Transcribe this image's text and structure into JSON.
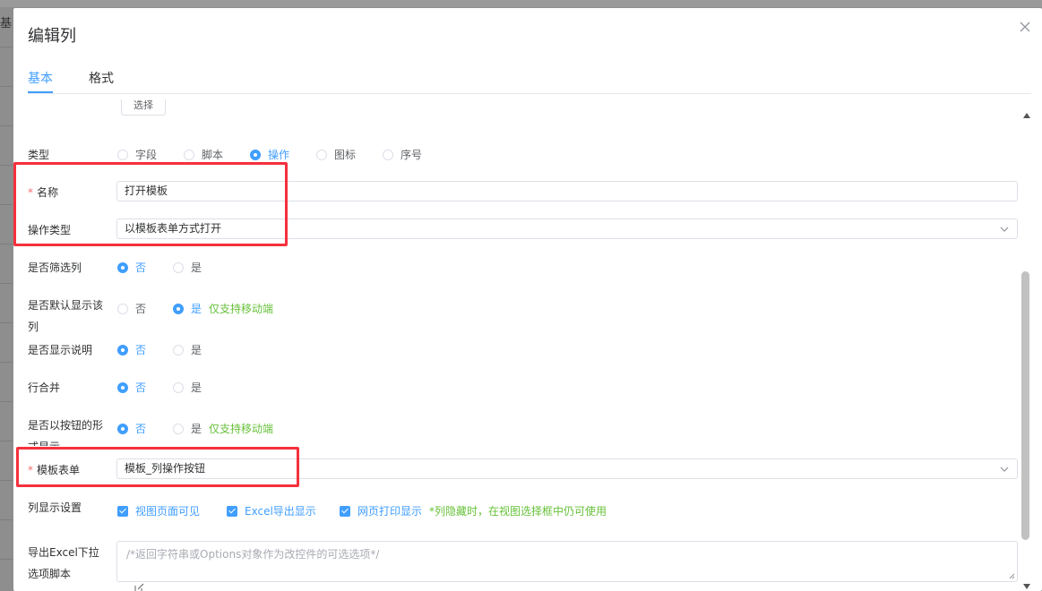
{
  "backdrop": {
    "partial_text": "基本"
  },
  "dialog": {
    "title": "编辑列"
  },
  "tabs": [
    {
      "label": "基本",
      "active": true
    },
    {
      "label": "格式",
      "active": false
    }
  ],
  "form": {
    "select_button": "选择",
    "type": {
      "label": "类型",
      "options": [
        "字段",
        "脚本",
        "操作",
        "图标",
        "序号"
      ],
      "selected": "操作"
    },
    "name": {
      "label": "名称",
      "required": true,
      "value": "打开模板"
    },
    "action_type": {
      "label": "操作类型",
      "value": "以模板表单方式打开"
    },
    "filter_column": {
      "label": "是否筛选列",
      "options": [
        "否",
        "是"
      ],
      "selected": "否"
    },
    "default_show": {
      "label_line1": "是否默认显示该",
      "label_line2": "列",
      "options": [
        "否",
        "是"
      ],
      "selected": "是",
      "hint": "仅支持移动端"
    },
    "show_desc": {
      "label": "是否显示说明",
      "options": [
        "否",
        "是"
      ],
      "selected": "否"
    },
    "row_merge": {
      "label": "行合并",
      "options": [
        "否",
        "是"
      ],
      "selected": "否"
    },
    "show_as_button": {
      "label_line1": "是否以按钮的形",
      "label_line2": "式显示",
      "options": [
        "否",
        "是"
      ],
      "selected": "否",
      "hint": "仅支持移动端"
    },
    "template_form": {
      "label": "模板表单",
      "required": true,
      "value": "模板_列操作按钮"
    },
    "column_display": {
      "label": "列显示设置",
      "checkboxes": [
        "视图页面可见",
        "Excel导出显示",
        "网页打印显示"
      ],
      "hint": "*列隐藏时，在视图选择框中仍可使用"
    },
    "excel_script": {
      "label_line1": "导出Excel下拉",
      "label_line2": "选项脚本",
      "placeholder": "/*返回字符串或Options对象作为改控件的可选选项*/"
    }
  },
  "colors": {
    "primary": "#409eff",
    "success": "#67c23a",
    "danger": "#f56c6c",
    "highlight_box": "#f5303c"
  }
}
